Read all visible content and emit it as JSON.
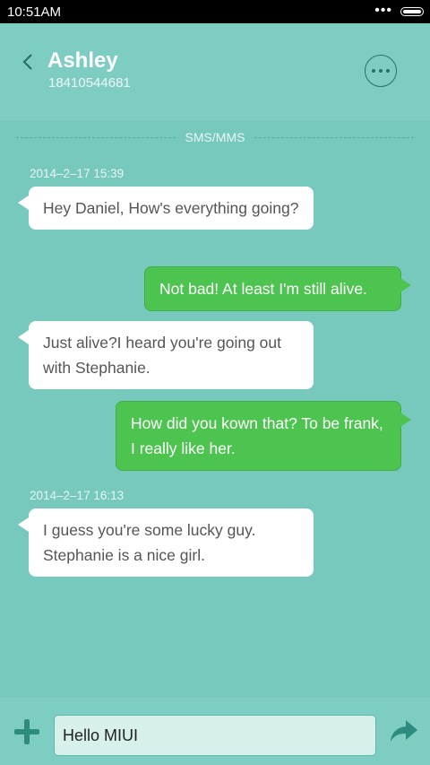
{
  "status_bar": {
    "time": "10:51AM",
    "signal": "•••"
  },
  "header": {
    "contact_name": "Ashley",
    "phone_number": "18410544681"
  },
  "conversation": {
    "channel_label": "SMS/MMS",
    "timestamps": [
      "2014–2–17 15:39",
      "2014–2–17 16:13"
    ],
    "messages": [
      {
        "direction": "incoming",
        "text": "Hey Daniel, How's everything going?"
      },
      {
        "direction": "outgoing",
        "text": "Not bad! At least I'm still alive."
      },
      {
        "direction": "incoming",
        "text": "Just  alive?I heard you're going out with Stephanie."
      },
      {
        "direction": "outgoing",
        "text": "How did you kown that? To be frank, I really like her."
      },
      {
        "direction": "incoming",
        "text": "I guess you're some lucky guy. Stephanie is a nice girl."
      }
    ]
  },
  "composer": {
    "input_value": "Hello MIUI"
  },
  "icons": {
    "back": "chevron-left-icon",
    "more": "more-options-icon",
    "add": "plus-icon",
    "send": "send-arrow-icon"
  },
  "colors": {
    "header": "#7ecdc3",
    "chat_background": "#77c9bd",
    "outgoing_bubble": "#4ec450",
    "incoming_bubble": "#ffffff",
    "accent_icon": "#2e8c7e"
  }
}
